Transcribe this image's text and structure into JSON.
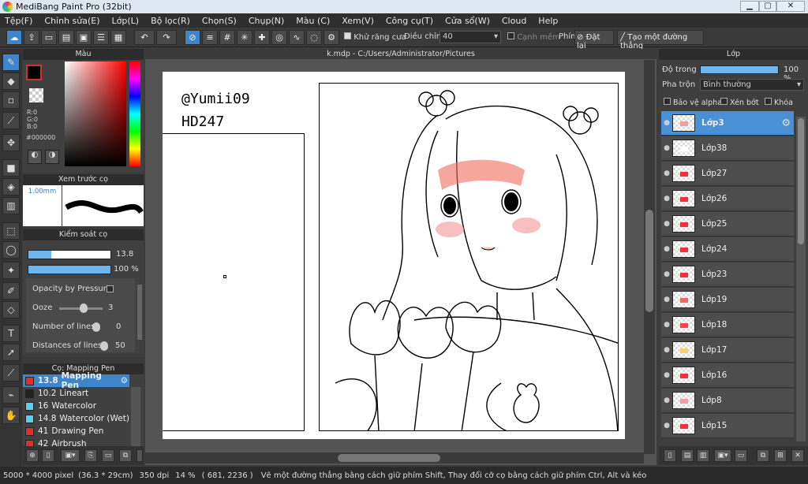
{
  "window": {
    "title": "MediBang Paint Pro (32bit)",
    "min": "▁",
    "max": "▢",
    "close": "✕"
  },
  "menu": [
    "Tệp(F)",
    "Chỉnh sửa(E)",
    "Lớp(L)",
    "Bộ lọc(R)",
    "Chọn(S)",
    "Chụp(N)",
    "Màu (C)",
    "Xem(V)",
    "Công cụ(T)",
    "Cửa sổ(W)",
    "Cloud",
    "Help"
  ],
  "toolbar": {
    "antialias_label": "Khử răng cưa",
    "adjust_label": "Điều chỉnh",
    "adjust_value": "40",
    "smooth_edge_label": "Cạnh mềm",
    "key_label": "Phím",
    "reset_label": "Đặt lại",
    "straight_line_label": "Tạo một đường thẳng"
  },
  "color_panel": {
    "title": "Màu",
    "r": "R:0",
    "g": "G:0",
    "b": "B:0",
    "hex": "#000000",
    "primary_color": "#000000",
    "accent": "#3e86c9"
  },
  "brush_preview": {
    "title": "Xem trước cọ",
    "size": "1.00mm"
  },
  "brush_control": {
    "title": "Kiểm soát cọ",
    "size_value": "13.8",
    "size_level": 0.28,
    "opacity_value": "100 %",
    "opacity_level": 1.0,
    "opacity_pressure_label": "Opacity by Pressure",
    "ooze_label": "Ooze",
    "ooze_value": "3",
    "lines_label": "Number of lines",
    "lines_value": "0",
    "distance_label": "Distances of lines",
    "distance_value": "50"
  },
  "brush_list": {
    "title": "Cọ: Mapping Pen",
    "items": [
      {
        "size": "13.8",
        "name": "Mapping Pen",
        "color": "#e03030",
        "selected": true
      },
      {
        "size": "10.2",
        "name": "Lineart",
        "color": "#222222",
        "selected": false
      },
      {
        "size": "16",
        "name": "Watercolor",
        "color": "#5ad0f0",
        "selected": false
      },
      {
        "size": "14.8",
        "name": "Watercolor (Wet)",
        "color": "#5ad0f0",
        "selected": false
      },
      {
        "size": "41",
        "name": "Drawing Pen",
        "color": "#e03030",
        "selected": false
      },
      {
        "size": "42",
        "name": "Airbrush",
        "color": "#e03030",
        "selected": false
      }
    ]
  },
  "canvas": {
    "tab_title": "k.mdp - C:/Users/Administrator/Pictures",
    "text_line1": "@Yumii09",
    "text_line2": "HD247"
  },
  "layer_panel": {
    "title": "Lớp",
    "opacity_label": "Độ trong",
    "opacity_value": "100 %",
    "opacity_level": 1.0,
    "blend_label": "Pha trộn",
    "blend_value": "Bình thường",
    "protect_alpha": "Bảo vệ alpha",
    "clipping": "Xén bớt",
    "lock": "Khóa",
    "layers": [
      {
        "name": "Lớp3",
        "selected": true
      },
      {
        "name": "Lớp38",
        "selected": false
      },
      {
        "name": "Lớp27",
        "selected": false
      },
      {
        "name": "Lớp26",
        "selected": false
      },
      {
        "name": "Lớp25",
        "selected": false
      },
      {
        "name": "Lớp24",
        "selected": false
      },
      {
        "name": "Lớp23",
        "selected": false
      },
      {
        "name": "Lớp19",
        "selected": false
      },
      {
        "name": "Lớp18",
        "selected": false
      },
      {
        "name": "Lớp17",
        "selected": false
      },
      {
        "name": "Lớp16",
        "selected": false
      },
      {
        "name": "Lớp8",
        "selected": false
      },
      {
        "name": "Lớp15",
        "selected": false
      }
    ]
  },
  "status": {
    "size": "5000 * 4000 pixel",
    "cm": "(36.3 * 29cm)",
    "dpi": "350 dpi",
    "zoom": "14 %",
    "coords": "( 681, 2236 )",
    "hint": "Vẽ một đường thẳng bằng cách giữ phím Shift, Thay đổi cỡ cọ bằng cách giữ phím Ctrl, Alt và kéo"
  }
}
